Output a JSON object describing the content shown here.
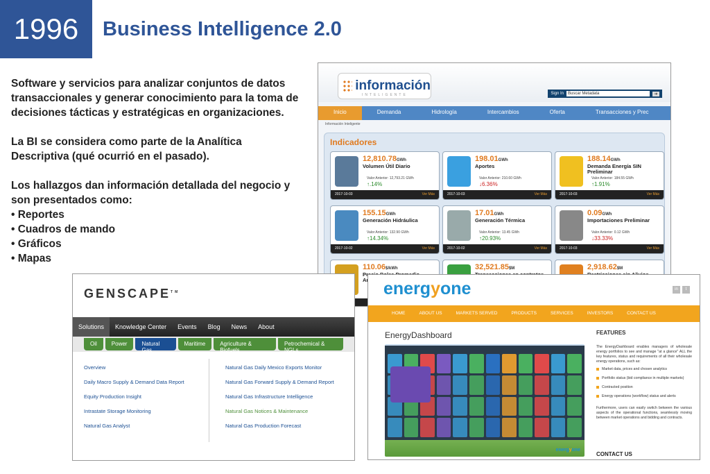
{
  "slide": {
    "year": "1996",
    "title": "Business Intelligence 2.0",
    "paragraphs": [
      "Software y servicios para analizar conjuntos de datos transaccionales y generar conocimiento para la toma de decisiones tácticas y estratégicas en organizaciones.",
      "La BI se considera como parte de la Analítica Descriptiva (qué ocurrió en el pasado).",
      "Los hallazgos dan información detallada del negocio y son presentados como:"
    ],
    "bullets": [
      "• Reportes",
      "• Cuadros de mando",
      "• Gráficos",
      "• Mapas"
    ]
  },
  "informacion": {
    "logo": "información",
    "logo_sub": "INTELIGENTE",
    "sign_in": "Sign In",
    "search_placeholder": "Buscar Metadata",
    "nav": [
      "Inicio",
      "Demanda",
      "Hidrología",
      "Intercambios",
      "Oferta",
      "Transacciones y Prec"
    ],
    "crumb": "Información Inteligente",
    "panel_title": "Indicadores",
    "link": "Ver Más",
    "cards": [
      {
        "value": "12,810.78",
        "unit": "GWh",
        "name": "Volumen Útil Diario",
        "prev": "Valor Anterior: 12,793.21 GWh",
        "pct": "↑.14%",
        "dir": "up",
        "date": "2017-10-03",
        "color": "#5a7a9a"
      },
      {
        "value": "198.01",
        "unit": "GWh",
        "name": "Aportes",
        "prev": "Valor Anterior: 210.60 GWh",
        "pct": "↓6.36%",
        "dir": "dn",
        "date": "2017-10-03",
        "color": "#3aa0e0"
      },
      {
        "value": "188.14",
        "unit": "GWh",
        "name": "Demanda Energía SIN Preliminar",
        "prev": "Valor Anterior: 184.55 GWh",
        "pct": "↑1.91%",
        "dir": "up",
        "date": "2017-10-03",
        "color": "#f0c020"
      },
      {
        "value": "155.15",
        "unit": "GWh",
        "name": "Generación Hidráulica",
        "prev": "Valor Anterior: 132.90 GWh",
        "pct": "↑14.34%",
        "dir": "up",
        "date": "2017-10-02",
        "color": "#4a8ac0"
      },
      {
        "value": "17.01",
        "unit": "GWh",
        "name": "Generación Térmica",
        "prev": "Valor Anterior: 13.45 GWh",
        "pct": "↑20.93%",
        "dir": "up",
        "date": "2017-10-02",
        "color": "#9aa"
      },
      {
        "value": "0.09",
        "unit": "GWh",
        "name": "Importaciones Preliminar",
        "prev": "Valor Anterior: 0.12 GWh",
        "pct": "↓33.33%",
        "dir": "dn",
        "date": "2017-10-03",
        "color": "#888"
      },
      {
        "value": "110.06",
        "unit": "$/kWh",
        "name": "Precio Bolsa Promedio Aritmético TX1",
        "prev": "",
        "pct": "",
        "dir": "up",
        "date": "2017-10-03",
        "color": "#d4a020"
      },
      {
        "value": "32,521.85",
        "unit": "$M",
        "name": "Transacciones en contratos",
        "prev": "",
        "pct": "",
        "dir": "up",
        "date": "",
        "color": "#3aa040"
      },
      {
        "value": "2,918.62",
        "unit": "$M",
        "name": "Restricciones sin Alivios",
        "prev": "Valor Anterior: 2,618.43 $M",
        "pct": "",
        "dir": "up",
        "date": "",
        "color": "#e08020"
      }
    ]
  },
  "genscape": {
    "logo": "GENSCAPE",
    "tm": "TM",
    "nav": [
      "Solutions",
      "Knowledge Center",
      "Events",
      "Blog",
      "News",
      "About"
    ],
    "subnav": [
      "Oil",
      "Power",
      "Natural Gas",
      "Maritime",
      "Agriculture & Biofuels",
      "Petrochemical & NGLs"
    ],
    "left_links": [
      "Overview",
      "Daily Macro Supply & Demand Data Report",
      "Equity Production Insight",
      "Intrastate Storage Monitoring",
      "Natural Gas Analyst"
    ],
    "right_links": [
      "Natural Gas Daily Mexico Exports Monitor",
      "Natural Gas Forward Supply & Demand Report",
      "Natural Gas Infrastructure Intelligence",
      "Natural Gas Notices & Maintenance",
      "Natural Gas Production Forecast"
    ]
  },
  "energyone": {
    "logo_a": "energ",
    "logo_b": "y",
    "logo_c": "one",
    "social": [
      "in",
      "t"
    ],
    "nav": [
      "HOME",
      "ABOUT US",
      "MARKETS SERVED",
      "PRODUCTS",
      "SERVICES",
      "INVESTORS",
      "CONTACT US"
    ],
    "dash_title": "EnergyDashboard",
    "features_title": "FEATURES",
    "features_intro": "The EnergyDashboard enables managers of wholesale energy portfolios to see and manage \"at a glance\" ALL the key features, status and requirements of all their wholesale energy operations, such as:",
    "features": [
      "Market data, prices and chosen analytics",
      "Portfolio status (bid compliance in multiple markets)",
      "Contracted position",
      "Energy operations (workflow) status and alerts"
    ],
    "features_outro": "Furthermore, users can easily switch between the various aspects of the operational functions, seamlessly moving between market operations and bidding and contracts.",
    "contact": "CONTACT US"
  }
}
